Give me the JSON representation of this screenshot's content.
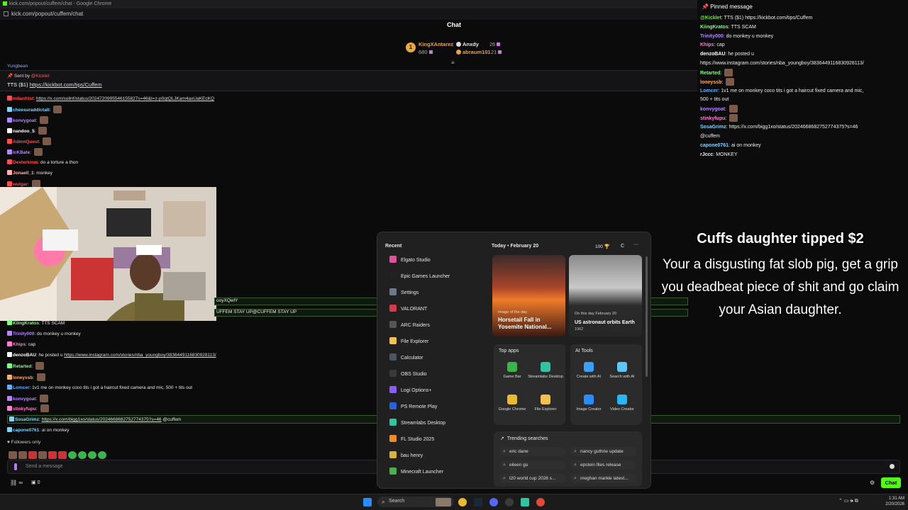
{
  "browser": {
    "window_title": "kick.com/popout/cuffem/chat - Google Chrome",
    "url": "kick.com/popout/cuffem/chat"
  },
  "chat": {
    "title": "Chat",
    "top_gifters": [
      {
        "name": "KingXAntarez",
        "count": "680",
        "rank": "1"
      },
      {
        "name": "Anxdy",
        "count": "26"
      },
      {
        "name": "abraum101",
        "count": "21"
      }
    ],
    "partial_line": "Yungbean",
    "pinned_tts": {
      "sent_by_label": "Sent by",
      "sender": "@Kicklet",
      "text_prefix": "TTS ($1)",
      "link": "https://kickbot.com/tips/Cuffem"
    },
    "lines": [
      {
        "user": "milanfrist",
        "color": "#ff4d4d",
        "text": "",
        "link": "https://x.com/soilnf/status/2024720995546155827s=46&t=z-p0qtQLJKam4axUaKEcKQ"
      },
      {
        "user": "cheesuraddictalt",
        "color": "#7fd3ff",
        "text": ""
      },
      {
        "user": "konvygoat",
        "color": "#b388ff",
        "text": ""
      },
      {
        "user": "nandoo_5",
        "color": "#ffffff",
        "text": ""
      },
      {
        "user": "AdmnQuest",
        "color": "#ff4d4d",
        "text": ""
      },
      {
        "user": "lcKBate",
        "color": "#b388ff",
        "text": ""
      },
      {
        "user": "Dexterkmm",
        "color": "#ff4d4d",
        "text": "do a torture a thon"
      },
      {
        "user": "Jonaell_1",
        "color": "#ffb0b0",
        "text": "monkey"
      },
      {
        "user": "wulgar",
        "color": "#ff4d4d",
        "text": ""
      }
    ],
    "cam_edge_lines": [
      "ooyXQwlY",
      "UFFEM STAY UP@CUFFEM STAY UP"
    ],
    "lower_lines": [
      {
        "user": "KiingKratos",
        "color": "#7fff7f",
        "text": "TTS",
        "extra": "SCAM"
      },
      {
        "user": "Trinity000",
        "color": "#b388ff",
        "text": "do monkey u monkey"
      },
      {
        "user": "Khips",
        "color": "#ff7fd0",
        "text": "cap"
      },
      {
        "user": "denzoBAU",
        "color": "#ffffff",
        "text": "he posted u",
        "link": "https://www.instagram.com/stories/nba_youngboy/3836449116830928113/"
      },
      {
        "user": "Retarted",
        "color": "#7fff7f",
        "text": ""
      },
      {
        "user": "loneyssb",
        "color": "#ffb060",
        "text": ""
      },
      {
        "user": "Lomcer",
        "color": "#5fb0ff",
        "text": "1v1 me on monkey coco tits i got a haircut fixed camera and mic, 500 + tits out"
      },
      {
        "user": "konvygoat",
        "color": "#b388ff",
        "text": ""
      },
      {
        "user": "stinkyfupu",
        "color": "#ff7fd0",
        "text": ""
      },
      {
        "user": "SosaGrimz",
        "color": "#7fd3ff",
        "text": "",
        "link": "https://x.com/bigg1xo/status/2024668682752774375?s=46",
        "extra": "@cuffem"
      },
      {
        "user": "capone0761",
        "color": "#7fd3ff",
        "text": "ai on monkey"
      }
    ],
    "followers_only": "Followers only",
    "send_placeholder": "Send a message",
    "send_button": "Chat",
    "bottom_count": "0"
  },
  "right_chat": {
    "header": "Pinned message",
    "lines": [
      {
        "user": "@Kicklet",
        "color": "#53fc18",
        "text": "TTS ($1) https://kickbot.com/tips/Cuffem"
      },
      {
        "user": "KiingKratos",
        "color": "#7fff7f",
        "text": "TTS  SCAM"
      },
      {
        "user": "Trinity000",
        "color": "#b388ff",
        "text": "do monkey u monkey"
      },
      {
        "user": "Khips",
        "color": "#ff7fd0",
        "text": "cap"
      },
      {
        "user": "denzoBAU",
        "color": "#ffffff",
        "text": "he posted u"
      },
      {
        "user": "",
        "color": "#eeeeee",
        "text": "https://www.instagram.com/stories/nba_youngboy/3836449116830928113/"
      },
      {
        "user": "Retarted",
        "color": "#7fff7f",
        "text": ""
      },
      {
        "user": "loneyssb",
        "color": "#ffb060",
        "text": ""
      },
      {
        "user": "Lomcer",
        "color": "#5fb0ff",
        "text": "1v1 me on monkey coco tits i got a haircut fixed camera and mic,"
      },
      {
        "user": "",
        "color": "#eeeeee",
        "text": "500 + tits out"
      },
      {
        "user": "konvygoat",
        "color": "#b388ff",
        "text": ""
      },
      {
        "user": "stinkyfupu",
        "color": "#ff7fd0",
        "text": ""
      },
      {
        "user": "SosaGrimz",
        "color": "#7fd3ff",
        "text": "https://x.com/bigg1xo/status/2024668682752774375?s=46"
      },
      {
        "user": "",
        "color": "#eeeeee",
        "text": "@cuffem"
      },
      {
        "user": "capone0761",
        "color": "#7fd3ff",
        "text": "ai on monkey"
      },
      {
        "user": "rJccc",
        "color": "#eeeeee",
        "text": "MONKEY"
      }
    ]
  },
  "tip_alert": {
    "title": "Cuffs daughter tipped $2",
    "message": "Your a disgusting fat slob pig, get a grip you deadbeat piece of shit and go claim your Asian daughter."
  },
  "start_menu": {
    "recent_label": "Recent",
    "apps": [
      {
        "name": "Elgato Studio",
        "color": "#e0529c"
      },
      {
        "name": "Epic Games Launcher",
        "color": "#222222"
      },
      {
        "name": "Settings",
        "color": "#6b7b8c"
      },
      {
        "name": "VALORANT",
        "color": "#d63a4a"
      },
      {
        "name": "ARC Raiders",
        "color": "#555555"
      },
      {
        "name": "File Explorer",
        "color": "#f2c14e"
      },
      {
        "name": "Calculator",
        "color": "#4b5563"
      },
      {
        "name": "OBS Studio",
        "color": "#3a3a3a"
      },
      {
        "name": "Logi Options+",
        "color": "#8c5cf5"
      },
      {
        "name": "PS Remote Play",
        "color": "#2b62d9"
      },
      {
        "name": "Streamlabs Desktop",
        "color": "#31c3a2"
      },
      {
        "name": "FL Studio 2025",
        "color": "#f08a24"
      },
      {
        "name": "bau henry",
        "color": "#d8b23a"
      },
      {
        "name": "Minecraft Launcher",
        "color": "#4caf50"
      }
    ],
    "today_label": "Today",
    "date": "February 20",
    "points": "100",
    "avatar_letter": "C",
    "cards": [
      {
        "tag": "Image of the day",
        "title": "Horsetail Fall in Yosemite National..."
      },
      {
        "tag": "On this day February 20",
        "title": "US astronaut orbits Earth",
        "sub": "1962"
      }
    ],
    "top_apps_label": "Top apps",
    "top_apps": [
      {
        "name": "Game Bar",
        "color": "#3bb54a"
      },
      {
        "name": "Streamlabs Desktop",
        "color": "#31c3a2"
      },
      {
        "name": "Google Chrome",
        "color": "#e8b931"
      },
      {
        "name": "File Explorer",
        "color": "#f2c14e"
      }
    ],
    "ai_tools_label": "AI Tools",
    "ai_tools": [
      {
        "name": "Create with AI",
        "color": "#3aa0ff"
      },
      {
        "name": "Search with AI",
        "color": "#5ac8fa"
      },
      {
        "name": "Image Creator",
        "color": "#2b8cff"
      },
      {
        "name": "Video Creator",
        "color": "#29b6f6"
      }
    ],
    "trending_label": "Trending searches",
    "trending": [
      "eric dane",
      "nancy guthrie update",
      "eileen gu",
      "epstein files release",
      "t20 world cup 2026 s...",
      "meghan markle latest..."
    ]
  },
  "taskbar": {
    "search_placeholder": "Search",
    "time": "1:31 AM",
    "date": "2/20/2026"
  }
}
